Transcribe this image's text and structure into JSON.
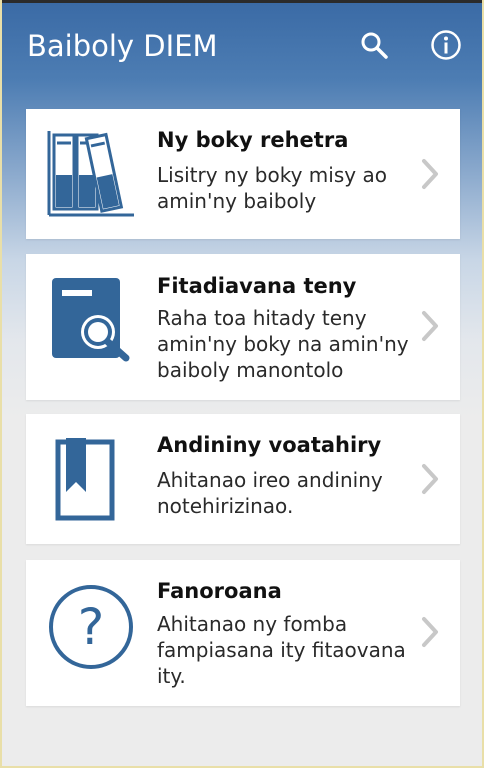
{
  "app": {
    "title": "Baiboly DIEM"
  },
  "toolbar": {
    "search_icon": "search-icon",
    "info_icon": "info-icon"
  },
  "colors": {
    "primary": "#3a6aa5",
    "icon_blue": "#336699",
    "background": "#ececec"
  },
  "menu": [
    {
      "title": "Ny boky rehetra",
      "subtitle": "Lisitry ny boky misy ao amin'ny baiboly",
      "icon": "bookshelf-icon"
    },
    {
      "title": "Fitadiavana teny",
      "subtitle": "Raha toa hitady teny amin'ny boky na amin'ny baiboly manontolo",
      "icon": "book-search-icon"
    },
    {
      "title": "Andininy voatahiry",
      "subtitle": "Ahitanao ireo andininy notehirizinao.",
      "icon": "bookmark-icon"
    },
    {
      "title": "Fanoroana",
      "subtitle": "Ahitanao ny fomba fampiasana ity fitaovana ity.",
      "icon": "help-icon"
    }
  ]
}
